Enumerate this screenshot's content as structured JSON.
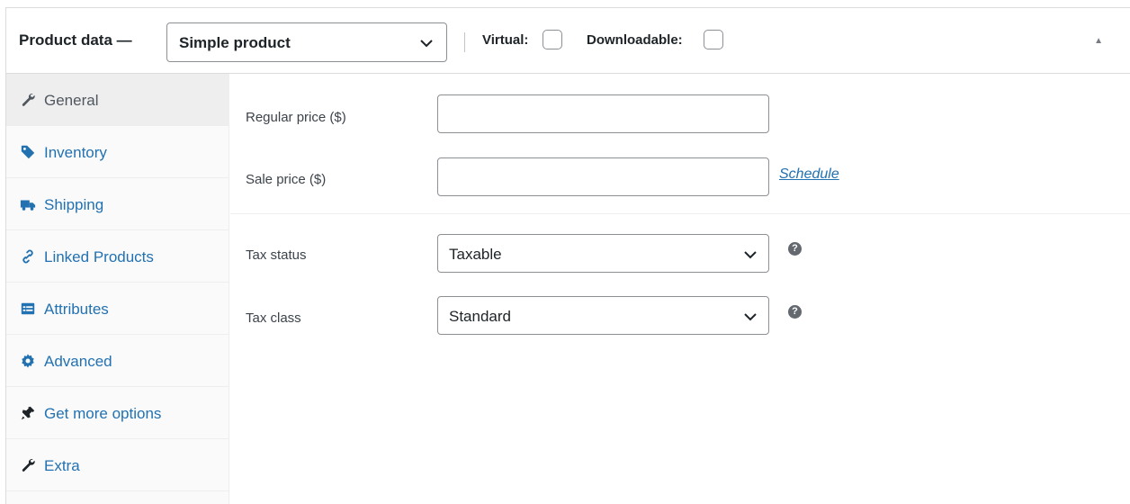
{
  "header": {
    "title": "Product data —",
    "product_type": "Simple product",
    "virtual_label": "Virtual:",
    "downloadable_label": "Downloadable:",
    "virtual_checked": false,
    "downloadable_checked": false
  },
  "tabs": [
    {
      "label": "General",
      "icon": "wrench-icon",
      "active": true
    },
    {
      "label": "Inventory",
      "icon": "tag-icon",
      "active": false
    },
    {
      "label": "Shipping",
      "icon": "truck-icon",
      "active": false
    },
    {
      "label": "Linked Products",
      "icon": "link-icon",
      "active": false
    },
    {
      "label": "Attributes",
      "icon": "list-view-icon",
      "active": false
    },
    {
      "label": "Advanced",
      "icon": "gear-icon",
      "active": false
    },
    {
      "label": "Get more options",
      "icon": "plugin-plug-icon",
      "active": false
    },
    {
      "label": "Extra",
      "icon": "wrench-icon",
      "active": false
    }
  ],
  "fields": {
    "regular_price": {
      "label": "Regular price ($)",
      "value": ""
    },
    "sale_price": {
      "label": "Sale price ($)",
      "value": "",
      "schedule_link": "Schedule"
    },
    "tax_status": {
      "label": "Tax status",
      "value": "Taxable",
      "help": "?"
    },
    "tax_class": {
      "label": "Tax class",
      "value": "Standard",
      "help": "?"
    }
  },
  "colors": {
    "accent": "#2271b1",
    "active_tab_bg": "#eeeeee",
    "sidebar_bg": "#fafafa"
  }
}
